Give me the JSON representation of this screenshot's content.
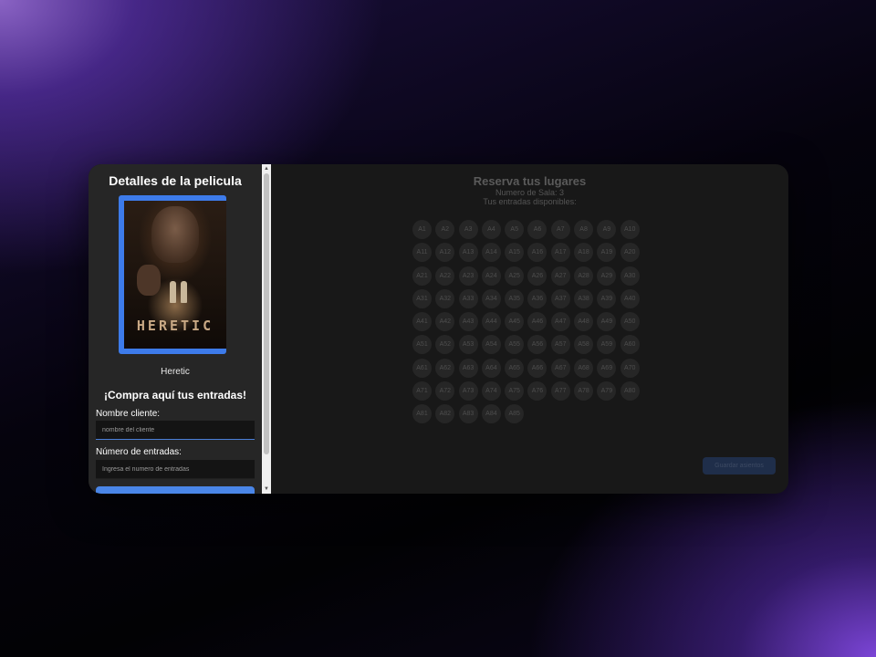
{
  "sidebar": {
    "title": "Detalles de la pelicula",
    "poster_title": "HERETIC",
    "movie_name": "Heretic",
    "buy_title": "¡Compra aquí tus entradas!",
    "name_label": "Nombre cliente:",
    "name_placeholder": "nombre del cliente",
    "qty_label": "Número de entradas:",
    "qty_placeholder": "Ingresa el numero de entradas",
    "buy_button": ""
  },
  "main": {
    "title": "Reserva tus lugares",
    "room": "Numero de Sala: 3",
    "available": "Tus entradas disponibles:",
    "save_button": "Guardar asientos",
    "seats": [
      "A1",
      "A2",
      "A3",
      "A4",
      "A5",
      "A6",
      "A7",
      "A8",
      "A9",
      "A10",
      "A11",
      "A12",
      "A13",
      "A14",
      "A15",
      "A16",
      "A17",
      "A18",
      "A19",
      "A20",
      "A21",
      "A22",
      "A23",
      "A24",
      "A25",
      "A26",
      "A27",
      "A28",
      "A29",
      "A30",
      "A31",
      "A32",
      "A33",
      "A34",
      "A35",
      "A36",
      "A37",
      "A38",
      "A39",
      "A40",
      "A41",
      "A42",
      "A43",
      "A44",
      "A45",
      "A46",
      "A47",
      "A48",
      "A49",
      "A50",
      "A51",
      "A52",
      "A53",
      "A54",
      "A55",
      "A56",
      "A57",
      "A58",
      "A59",
      "A60",
      "A61",
      "A62",
      "A63",
      "A64",
      "A65",
      "A66",
      "A67",
      "A68",
      "A69",
      "A70",
      "A71",
      "A72",
      "A73",
      "A74",
      "A75",
      "A76",
      "A77",
      "A78",
      "A79",
      "A80",
      "A81",
      "A82",
      "A83",
      "A84",
      "A85"
    ]
  },
  "colors": {
    "accent": "#4a86e8",
    "panel": "#262626",
    "main_bg": "#181818"
  }
}
